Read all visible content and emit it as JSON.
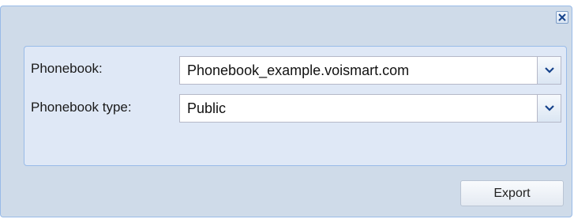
{
  "dialog": {
    "close_icon": "close-x-icon"
  },
  "form": {
    "phonebook_label": "Phonebook:",
    "phonebook_value": "Phonebook_example.voismart.com",
    "phonebook_type_label": "Phonebook type:",
    "phonebook_type_value": "Public",
    "dropdown_icon": "chevron-down-icon"
  },
  "footer": {
    "export_label": "Export"
  },
  "colors": {
    "window_bg": "#cfdbe9",
    "panel_bg": "#dfe8f6",
    "border": "#99bbe8",
    "icon_blue": "#15428b"
  }
}
